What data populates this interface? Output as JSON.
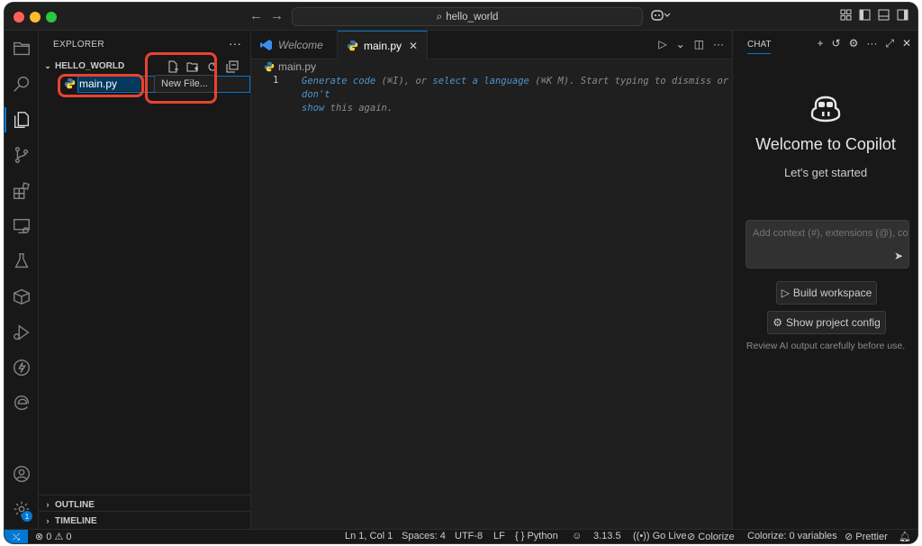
{
  "titlebar": {
    "search_text": "hello_world",
    "back_icon": "arrow-left-icon",
    "forward_icon": "arrow-right-icon"
  },
  "activity": {
    "items": [
      "explorer-icon",
      "search-icon",
      "source-control-icon",
      "run-debug-icon",
      "extensions-icon",
      "remote-explorer-icon",
      "testing-icon",
      "containers-icon",
      "deploy-icon",
      "flash-icon",
      "edge-icon",
      "account-icon",
      "settings-icon"
    ],
    "settings_badge": "1"
  },
  "sidebar": {
    "title": "EXPLORER",
    "more": "···",
    "folder": "HELLO_WORLD",
    "rename_value": "main.py",
    "tooltip": "New File...",
    "outline": "OUTLINE",
    "timeline": "TIMELINE"
  },
  "editor": {
    "tabs": [
      {
        "label": "Welcome"
      },
      {
        "label": "main.py"
      }
    ],
    "breadcrumb": "main.py",
    "line_number": "1",
    "hint": {
      "link1": "Generate code",
      "key1": " (⌘I), or ",
      "link2": "select a language",
      "key2": " (⌘K M). Start typing to dismiss or ",
      "link3": "don't",
      "line2_link": "show",
      "line2_rest": " this again."
    }
  },
  "chat": {
    "title": "CHAT",
    "welcome": "Welcome to Copilot",
    "subtitle": "Let's get started",
    "input_placeholder": "Add context (#), extensions (@), commands",
    "build_button": "Build workspace",
    "config_button": "Show project config",
    "note": "Review AI output carefully before use."
  },
  "status": {
    "errors": "0",
    "warnings": "0",
    "position": "Ln 1, Col 1",
    "spaces": "Spaces: 4",
    "encoding": "UTF-8",
    "eol": "LF",
    "language": "Python",
    "python_version": "3.13.5",
    "go_live": "Go Live",
    "colorize": "Colorize",
    "colorize_vars": "Colorize: 0 variables",
    "prettier": "Prettier"
  },
  "colors": {
    "accent": "#0078d4",
    "highlight": "#e8432e",
    "link": "#4e94ce"
  }
}
